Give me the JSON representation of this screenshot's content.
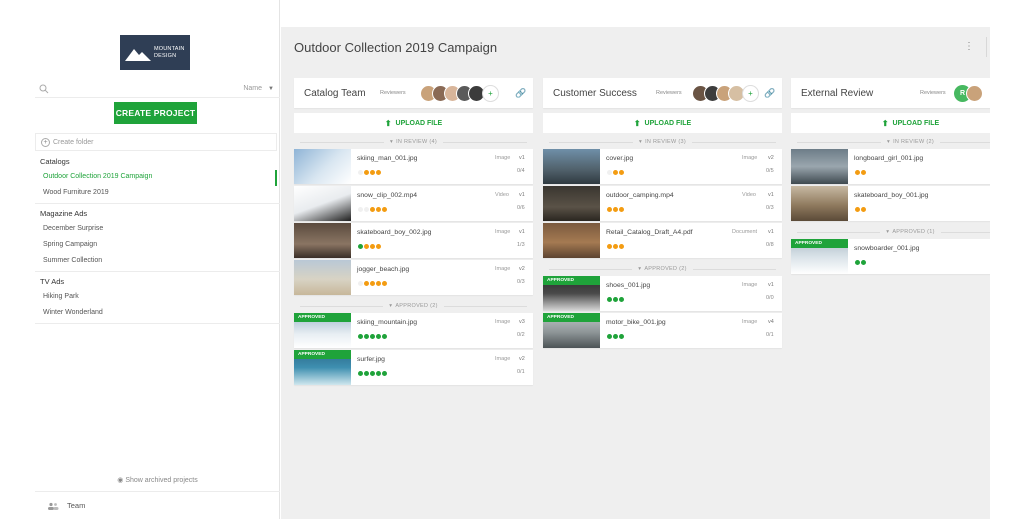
{
  "sidebar": {
    "logo_text_line1": "MOUNTAIN",
    "logo_text_line2": "DESIGN",
    "sort_label": "Name",
    "create_project": "CREATE PROJECT",
    "create_folder": "Create folder",
    "groups": [
      {
        "label": "Catalogs",
        "items": [
          "Outdoor Collection 2019 Campaign",
          "Wood Furniture 2019"
        ]
      },
      {
        "label": "Magazine Ads",
        "items": [
          "December Surprise",
          "Spring Campaign",
          "Summer Collection"
        ]
      },
      {
        "label": "TV Ads",
        "items": [
          "Hiking Park",
          "Winter Wonderland"
        ]
      }
    ],
    "show_archived": "Show archived projects",
    "team": "Team"
  },
  "main": {
    "title": "Outdoor Collection 2019 Campaign",
    "upload_label": "UPLOAD FILE",
    "reviewers_label": "Reviewers",
    "columns": [
      {
        "title": "Catalog Team",
        "in_review_label": "IN REVIEW (4)",
        "approved_label": "APPROVED (2)",
        "in_review": [
          {
            "name": "skiing_man_001.jpg",
            "type": "Image",
            "version": "v1",
            "count": "0/4",
            "dots": [
              "#f0f0f0",
              "#f39c12",
              "#f39c12",
              "#f39c12"
            ]
          },
          {
            "name": "snow_clip_002.mp4",
            "type": "Video",
            "version": "v1",
            "count": "0/6",
            "dots": [
              "#f0f0f0",
              "#f0f0f0",
              "#f39c12",
              "#f39c12",
              "#f39c12"
            ]
          },
          {
            "name": "skateboard_boy_002.jpg",
            "type": "Image",
            "version": "v1",
            "count": "1/3",
            "dots": [
              "#1fa33a",
              "#f39c12",
              "#f39c12",
              "#f39c12"
            ]
          },
          {
            "name": "jogger_beach.jpg",
            "type": "Image",
            "version": "v2",
            "count": "0/3",
            "dots": [
              "#f0f0f0",
              "#f39c12",
              "#f39c12",
              "#f39c12",
              "#f39c12"
            ]
          }
        ],
        "approved": [
          {
            "name": "skiing_mountain.jpg",
            "type": "Image",
            "version": "v3",
            "count": "0/2",
            "dots": [
              "#1fa33a",
              "#1fa33a",
              "#1fa33a",
              "#1fa33a",
              "#1fa33a"
            ]
          },
          {
            "name": "surfer.jpg",
            "type": "Image",
            "version": "v2",
            "count": "0/1",
            "dots": [
              "#1fa33a",
              "#1fa33a",
              "#1fa33a",
              "#1fa33a",
              "#1fa33a"
            ]
          }
        ]
      },
      {
        "title": "Customer Success",
        "in_review_label": "IN REVIEW (3)",
        "approved_label": "APPROVED (2)",
        "in_review": [
          {
            "name": "cover.jpg",
            "type": "Image",
            "version": "v2",
            "count": "0/5",
            "dots": [
              "#f0f0f0",
              "#f39c12",
              "#f39c12"
            ]
          },
          {
            "name": "outdoor_camping.mp4",
            "type": "Video",
            "version": "v1",
            "count": "0/3",
            "dots": [
              "#f39c12",
              "#f39c12",
              "#f39c12"
            ]
          },
          {
            "name": "Retail_Catalog_Draft_A4.pdf",
            "type": "Document",
            "version": "v1",
            "count": "0/8",
            "dots": [
              "#f39c12",
              "#f39c12",
              "#f39c12"
            ]
          }
        ],
        "approved": [
          {
            "name": "shoes_001.jpg",
            "type": "Image",
            "version": "v1",
            "count": "0/0",
            "dots": [
              "#1fa33a",
              "#1fa33a",
              "#1fa33a"
            ]
          },
          {
            "name": "motor_bike_001.jpg",
            "type": "Image",
            "version": "v4",
            "count": "0/1",
            "dots": [
              "#1fa33a",
              "#1fa33a",
              "#1fa33a"
            ]
          }
        ]
      },
      {
        "title": "External Review",
        "in_review_label": "IN REVIEW (2)",
        "approved_label": "APPROVED (1)",
        "avatar_letter": "R",
        "in_review": [
          {
            "name": "longboard_girl_001.jpg",
            "dots": [
              "#f39c12",
              "#f39c12"
            ]
          },
          {
            "name": "skateboard_boy_001.jpg",
            "dots": [
              "#f39c12",
              "#f39c12"
            ]
          }
        ],
        "approved": [
          {
            "name": "snowboarder_001.jpg",
            "dots": [
              "#1fa33a",
              "#1fa33a"
            ]
          }
        ]
      }
    ],
    "approved_tag": "APPROVED"
  },
  "colors": {
    "accent": "#1fa33a",
    "pending": "#f39c12",
    "logo_bg": "#2f3e55"
  }
}
